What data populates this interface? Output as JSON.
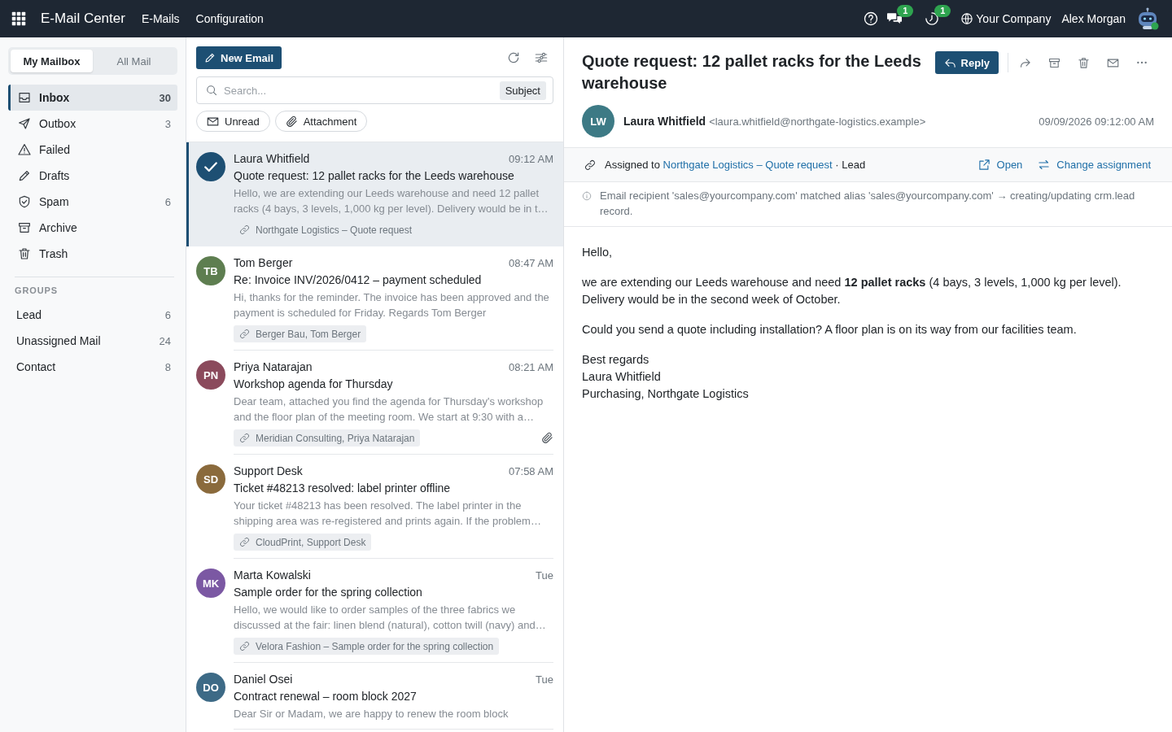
{
  "topbar": {
    "app_name": "E-Mail Center",
    "menu": [
      "E-Mails",
      "Configuration"
    ],
    "messages_count": "1",
    "activities_count": "1",
    "company": "Your Company",
    "user": "Alex Morgan"
  },
  "sidebar": {
    "scopes": [
      {
        "label": "My Mailbox",
        "selected": true
      },
      {
        "label": "All Mail",
        "selected": false
      }
    ],
    "folders": [
      {
        "kind": "inbox",
        "label": "Inbox",
        "count": "30",
        "selected": true
      },
      {
        "kind": "outbox",
        "label": "Outbox",
        "count": "3",
        "selected": false
      },
      {
        "kind": "failed",
        "label": "Failed",
        "selected": false
      },
      {
        "kind": "drafts",
        "label": "Drafts",
        "selected": false
      },
      {
        "kind": "spam",
        "label": "Spam",
        "count": "6",
        "selected": false
      },
      {
        "kind": "archive",
        "label": "Archive",
        "selected": false
      },
      {
        "kind": "trash",
        "label": "Trash",
        "selected": false
      }
    ],
    "groups_heading": "GROUPS",
    "groups": [
      {
        "label": "Lead",
        "count": "6",
        "selected": false
      },
      {
        "label": "Unassigned Mail",
        "count": "24",
        "selected": false
      },
      {
        "label": "Contact",
        "count": "8",
        "selected": false
      }
    ]
  },
  "list": {
    "new_email_button": "New Email",
    "search": {
      "placeholder": "Search...",
      "facet": "Subject"
    },
    "filters": [
      {
        "kind": "unread",
        "label": "Unread"
      },
      {
        "kind": "attachment",
        "label": "Attachment"
      }
    ],
    "messages": [
      {
        "selected": true,
        "sender": "Laura Whitfield",
        "time": "09:12 AM",
        "subject": "Quote request: 12 pallet racks for the Leeds warehouse",
        "preview": "Hello, we are extending our Leeds warehouse and need 12 pallet racks (4 bays, 3 levels, 1,000 kg per level). Delivery would be in t…",
        "link": "Northgate Logistics – Quote request",
        "has_attachment": false
      },
      {
        "selected": false,
        "initials": "TB",
        "color": "#5e7e50",
        "sender": "Tom Berger",
        "time": "08:47 AM",
        "subject": "Re: Invoice INV/2026/0412 – payment scheduled",
        "preview": "Hi, thanks for the reminder. The invoice has been approved and the payment is scheduled for Friday. Regards Tom Berger",
        "link": "Berger Bau, Tom Berger",
        "has_attachment": false
      },
      {
        "selected": false,
        "initials": "PN",
        "color": "#8b4a5c",
        "sender": "Priya Natarajan",
        "time": "08:21 AM",
        "subject": "Workshop agenda for Thursday",
        "preview": "Dear team, attached you find the agenda for Thursday's workshop and the floor plan of the meeting room. We start at 9:30 with a…",
        "link": "Meridian Consulting, Priya Natarajan",
        "has_attachment": true
      },
      {
        "selected": false,
        "initials": "SD",
        "color": "#8a6a3c",
        "sender": "Support Desk",
        "time": "07:58 AM",
        "subject": "Ticket #48213 resolved: label printer offline",
        "preview": "Your ticket #48213 has been resolved. The label printer in the shipping area was re-registered and prints again. If the problem…",
        "link": "CloudPrint, Support Desk",
        "has_attachment": false
      },
      {
        "selected": false,
        "initials": "MK",
        "color": "#7b58a3",
        "sender": "Marta Kowalski",
        "time": "Tue",
        "subject": "Sample order for the spring collection",
        "preview": "Hello, we would like to order samples of the three fabrics we discussed at the fair: linen blend (natural), cotton twill (navy) and…",
        "link": "Velora Fashion – Sample order for the spring collection",
        "has_attachment": false
      },
      {
        "selected": false,
        "initials": "DO",
        "color": "#3d6a86",
        "sender": "Daniel Osei",
        "time": "Tue",
        "subject": "Contract renewal – room block 2027",
        "preview": "Dear Sir or Madam, we are happy to renew the room block",
        "has_attachment": false
      }
    ]
  },
  "detail": {
    "subject": "Quote request: 12 pallet racks for the Leeds warehouse",
    "reply_button": "Reply",
    "sender": {
      "initials": "LW",
      "name": "Laura Whitfield",
      "email": "<laura.whitfield@northgate-logistics.example>",
      "date": "09/09/2026 09:12:00 AM"
    },
    "assignment": {
      "label": "Assigned to",
      "record": "Northgate Logistics – Quote request",
      "model": "· Lead",
      "open_link": "Open",
      "change_link": "Change assignment"
    },
    "notice": "Email recipient 'sales@yourcompany.com' matched alias 'sales@yourcompany.com' → creating/updating crm.lead record.",
    "body": [
      "Hello,",
      "we are extending our Leeds warehouse and need **12 pallet racks** (4 bays, 3 levels, 1,000 kg per level). Delivery would be in the second week of October.",
      "Could you send a quote including installation? A floor plan is on its way from our facilities team.",
      "Best regards\nLaura Whitfield\nPurchasing, Northgate Logistics"
    ]
  }
}
